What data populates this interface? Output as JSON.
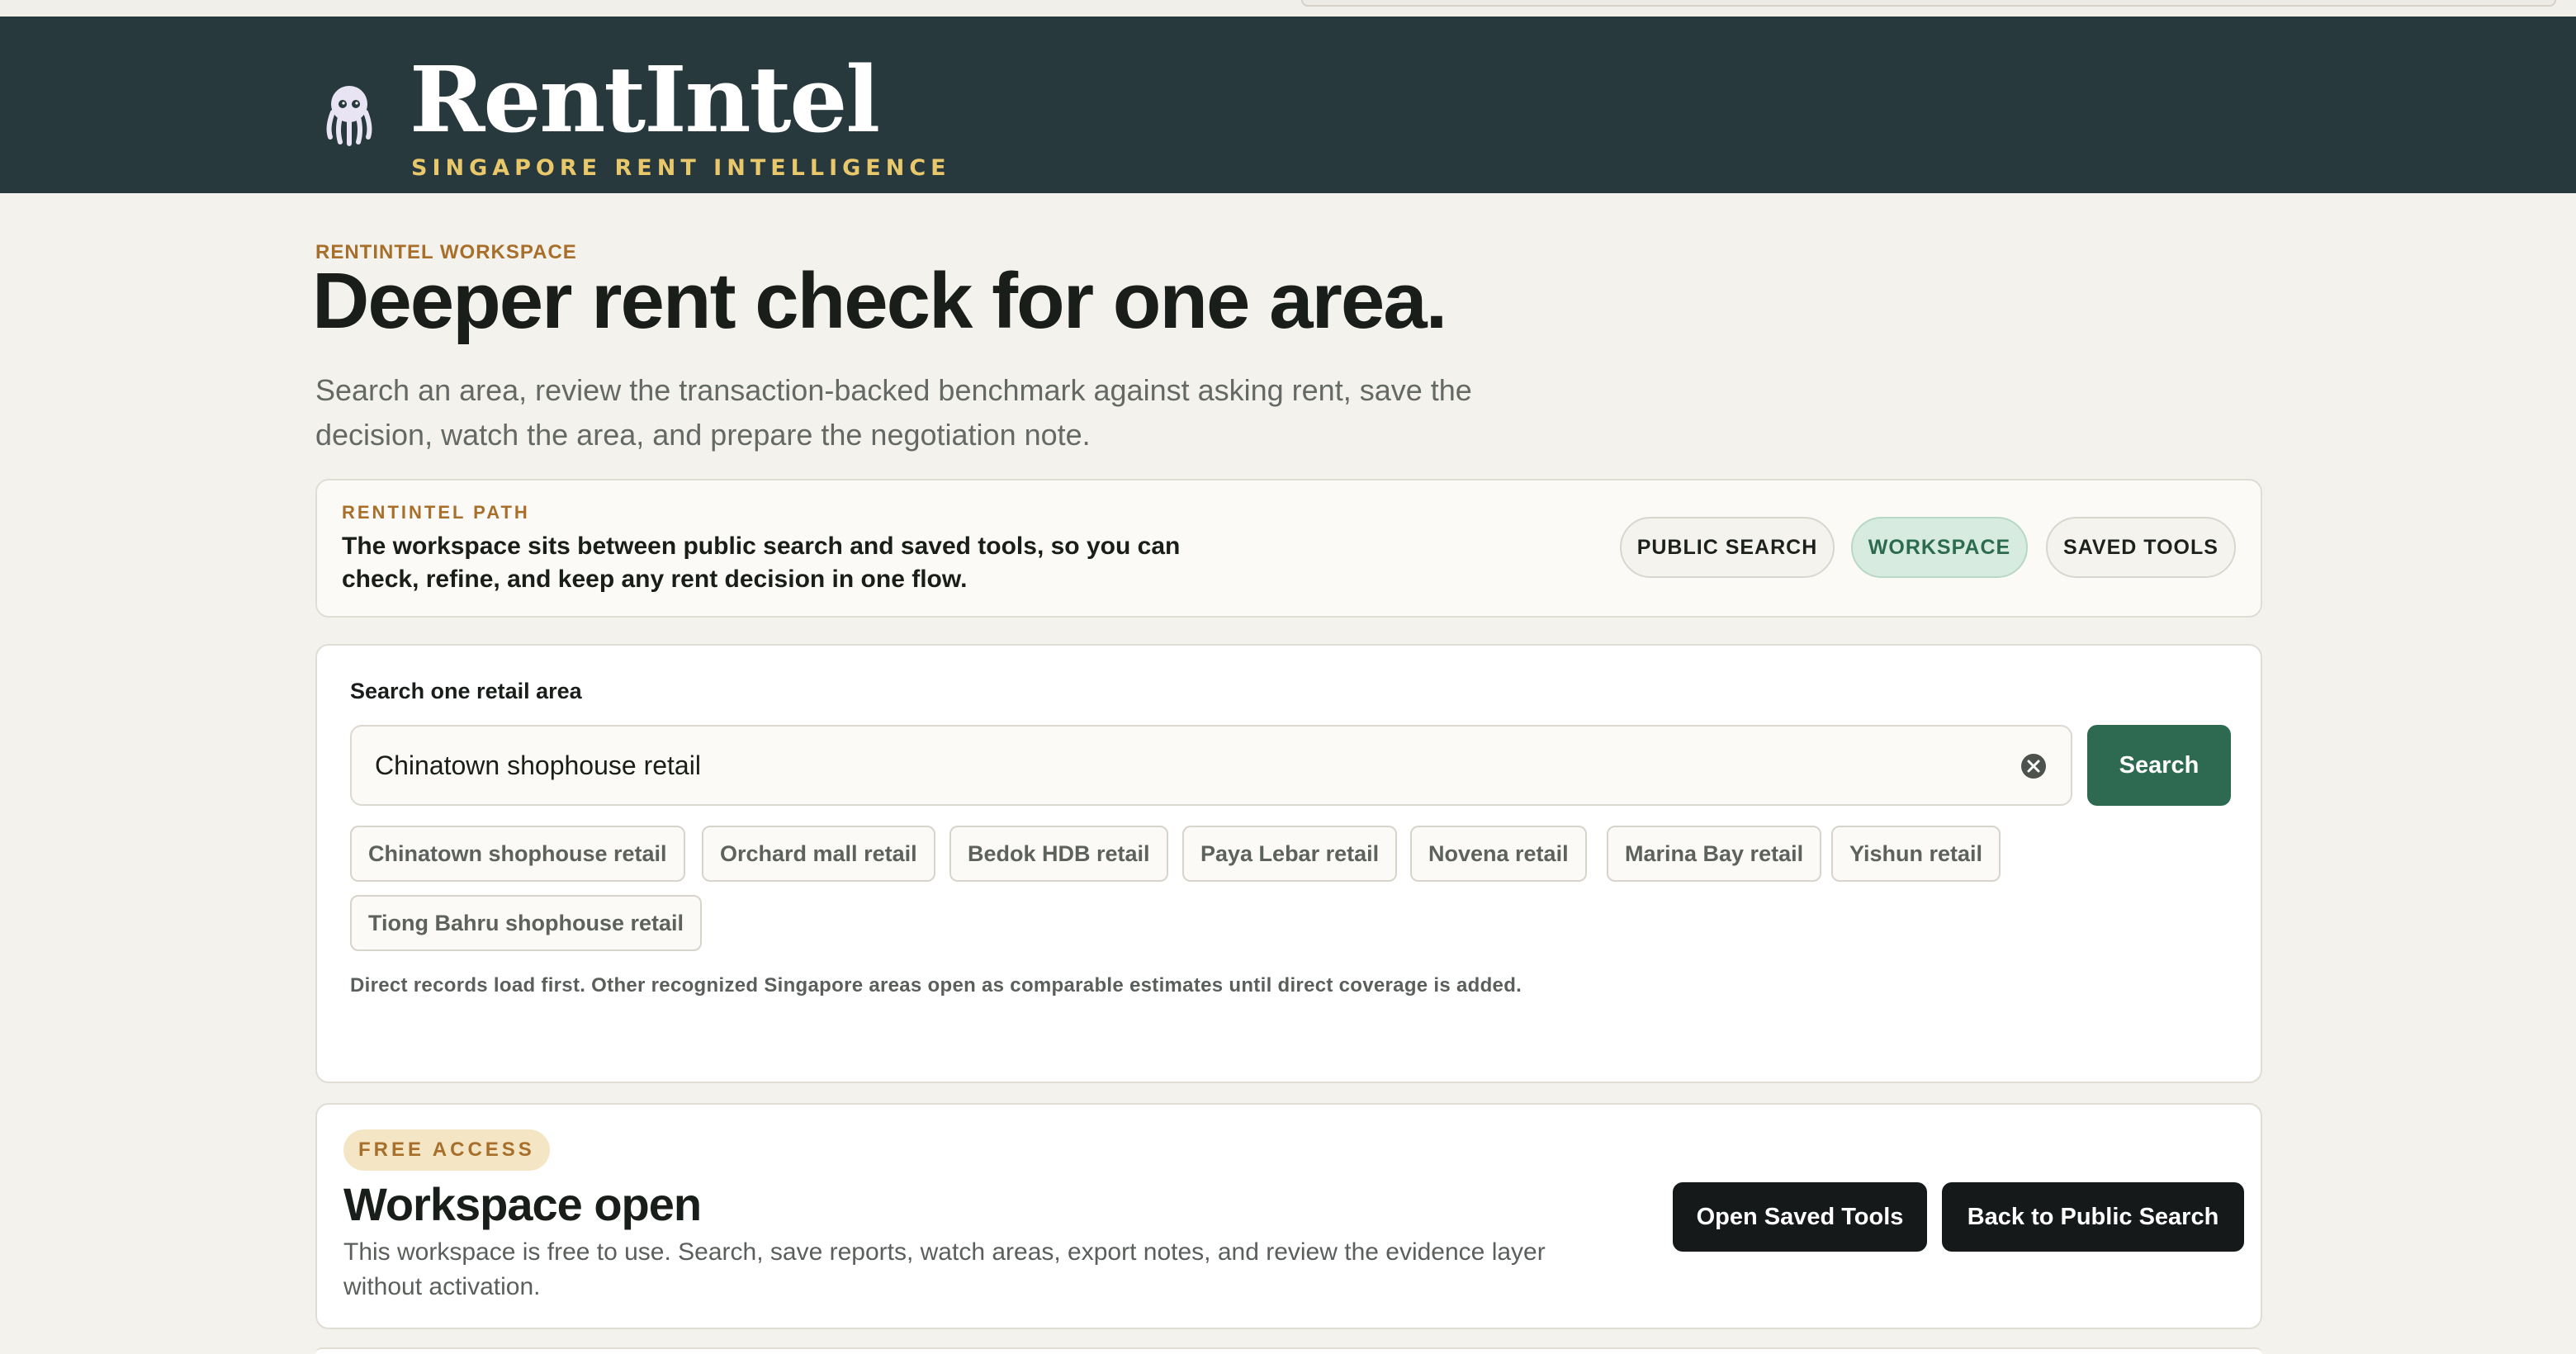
{
  "brand": {
    "name": "RentIntel",
    "tagline": "SINGAPORE RENT INTELLIGENCE",
    "logo_icon": "octopus-mascot-icon"
  },
  "hero": {
    "eyebrow": "RENTINTEL WORKSPACE",
    "title": "Deeper rent check for one area.",
    "intro_line1": "Search an area, review the transaction-backed benchmark against asking rent, save the",
    "intro_line2": "decision, watch the area, and prepare the negotiation note."
  },
  "path": {
    "eyebrow": "RENTINTEL PATH",
    "text_line1": "The workspace sits between public search and saved tools, so you can",
    "text_line2": "check, refine, and keep any rent decision in one flow.",
    "buttons": [
      {
        "label": "PUBLIC SEARCH",
        "active": false
      },
      {
        "label": "WORKSPACE",
        "active": true
      },
      {
        "label": "SAVED TOOLS",
        "active": false
      }
    ]
  },
  "search": {
    "label": "Search one retail area",
    "value": "Chinatown shophouse retail",
    "button_label": "Search",
    "clear_icon": "clear-circle-x-icon",
    "suggestions": [
      "Chinatown shophouse retail",
      "Orchard mall retail",
      "Bedok HDB retail",
      "Paya Lebar retail",
      "Novena retail",
      "Marina Bay retail",
      "Yishun retail",
      "Tiong Bahru shophouse retail"
    ],
    "note": "Direct records load first. Other recognized Singapore areas open as comparable estimates until direct coverage is added."
  },
  "access": {
    "badge": "FREE ACCESS",
    "title": "Workspace open",
    "desc_line1": "This workspace is free to use. Search, save reports, watch areas, export notes, and review the evidence layer",
    "desc_line2": "without activation.",
    "open_saved_label": "Open Saved Tools",
    "back_label": "Back to Public Search"
  },
  "colors": {
    "header_bg": "#27393d",
    "accent_gold": "#e9c76b",
    "accent_green": "#2e6a51",
    "eyebrow_brown": "#a86f2b"
  }
}
